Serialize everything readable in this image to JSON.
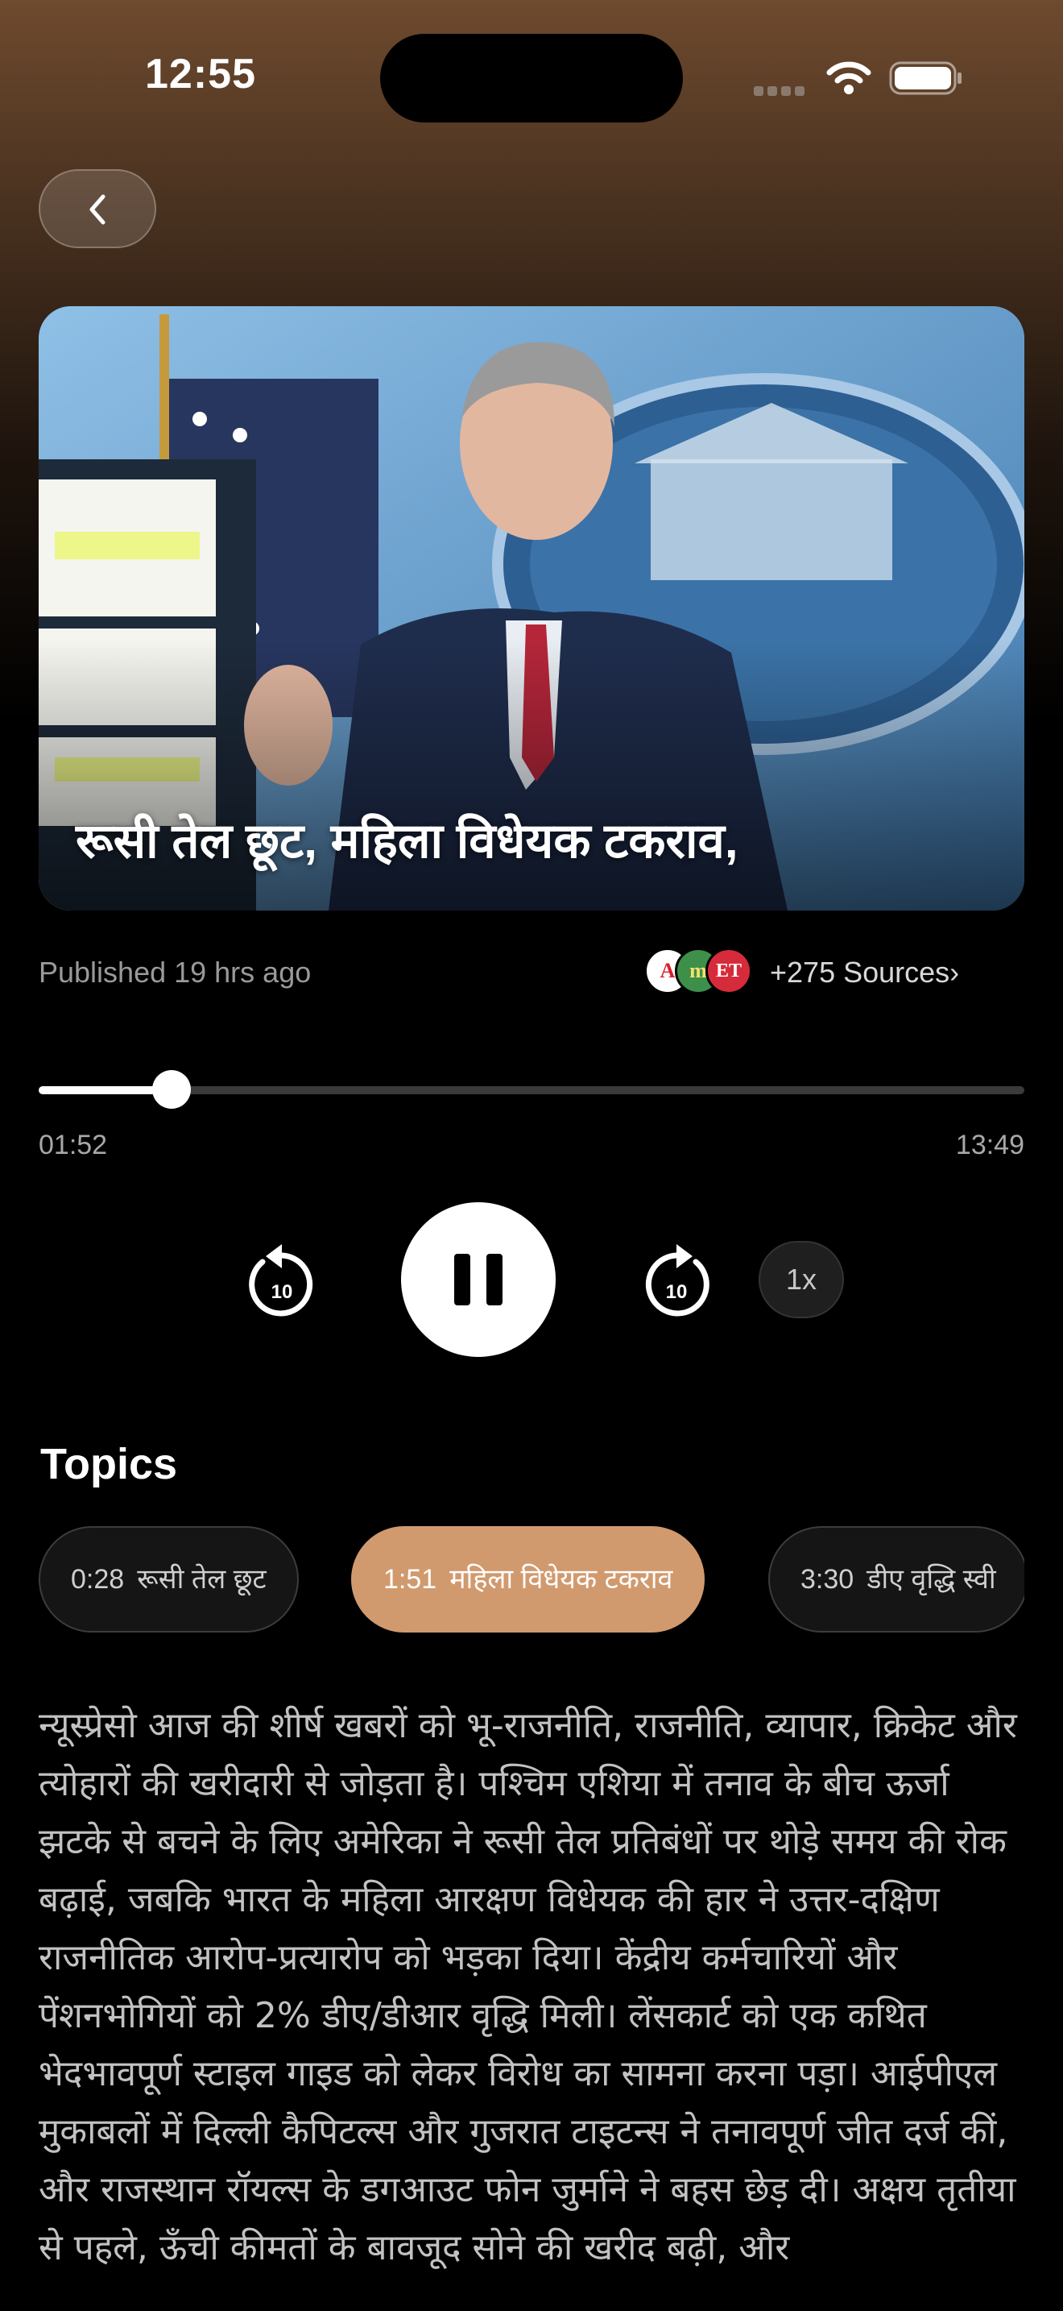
{
  "status_bar": {
    "time": "12:55"
  },
  "hero": {
    "title": "रूसी तेल छूट, महिला विधेयक टकराव,"
  },
  "meta": {
    "published": "Published 19 hrs ago",
    "source_icons": [
      "A",
      "m",
      "ET"
    ],
    "sources_label": "+275 Sources›"
  },
  "player": {
    "current_time": "01:52",
    "total_time": "13:49",
    "progress": 0.135,
    "rewind_label": "10",
    "forward_label": "10",
    "speed_label": "1x"
  },
  "topics": {
    "heading": "Topics",
    "chips": [
      {
        "time": "0:28",
        "label": "रूसी तेल छूट",
        "active": false
      },
      {
        "time": "1:51",
        "label": "महिला विधेयक टकराव",
        "active": true
      },
      {
        "time": "3:30",
        "label": "डीए वृद्धि स्वी",
        "active": false
      }
    ]
  },
  "summary": "न्यूस्प्रेसो आज की शीर्ष खबरों को भू-राजनीति, राजनीति, व्यापार, क्रिकेट और त्योहारों की खरीदारी से जोड़ता है। पश्चिम एशिया में तनाव के बीच ऊर्जा झटके से बचने के लिए अमेरिका ने रूसी तेल प्रतिबंधों पर थोड़े समय की रोक बढ़ाई, जबकि भारत के महिला आरक्षण विधेयक की हार ने उत्तर-दक्षिण राजनीतिक आरोप-प्रत्यारोप को भड़का दिया। केंद्रीय कर्मचारियों और पेंशनभोगियों को 2% डीए/डीआर वृद्धि मिली। लेंसकार्ट को एक कथित भेदभावपूर्ण स्टाइल गाइड को लेकर विरोध का सामना करना पड़ा। आईपीएल मुकाबलों में दिल्ली कैपिटल्स और गुजरात टाइटन्स ने तनावपूर्ण जीत दर्ज कीं, और राजस्थान रॉयल्स के डगआउट फोन जुर्माने ने बहस छेड़ दी। अक्षय तृतीया से पहले, ऊँची कीमतों के बावजूद सोने की खरीद बढ़ी, और"
}
